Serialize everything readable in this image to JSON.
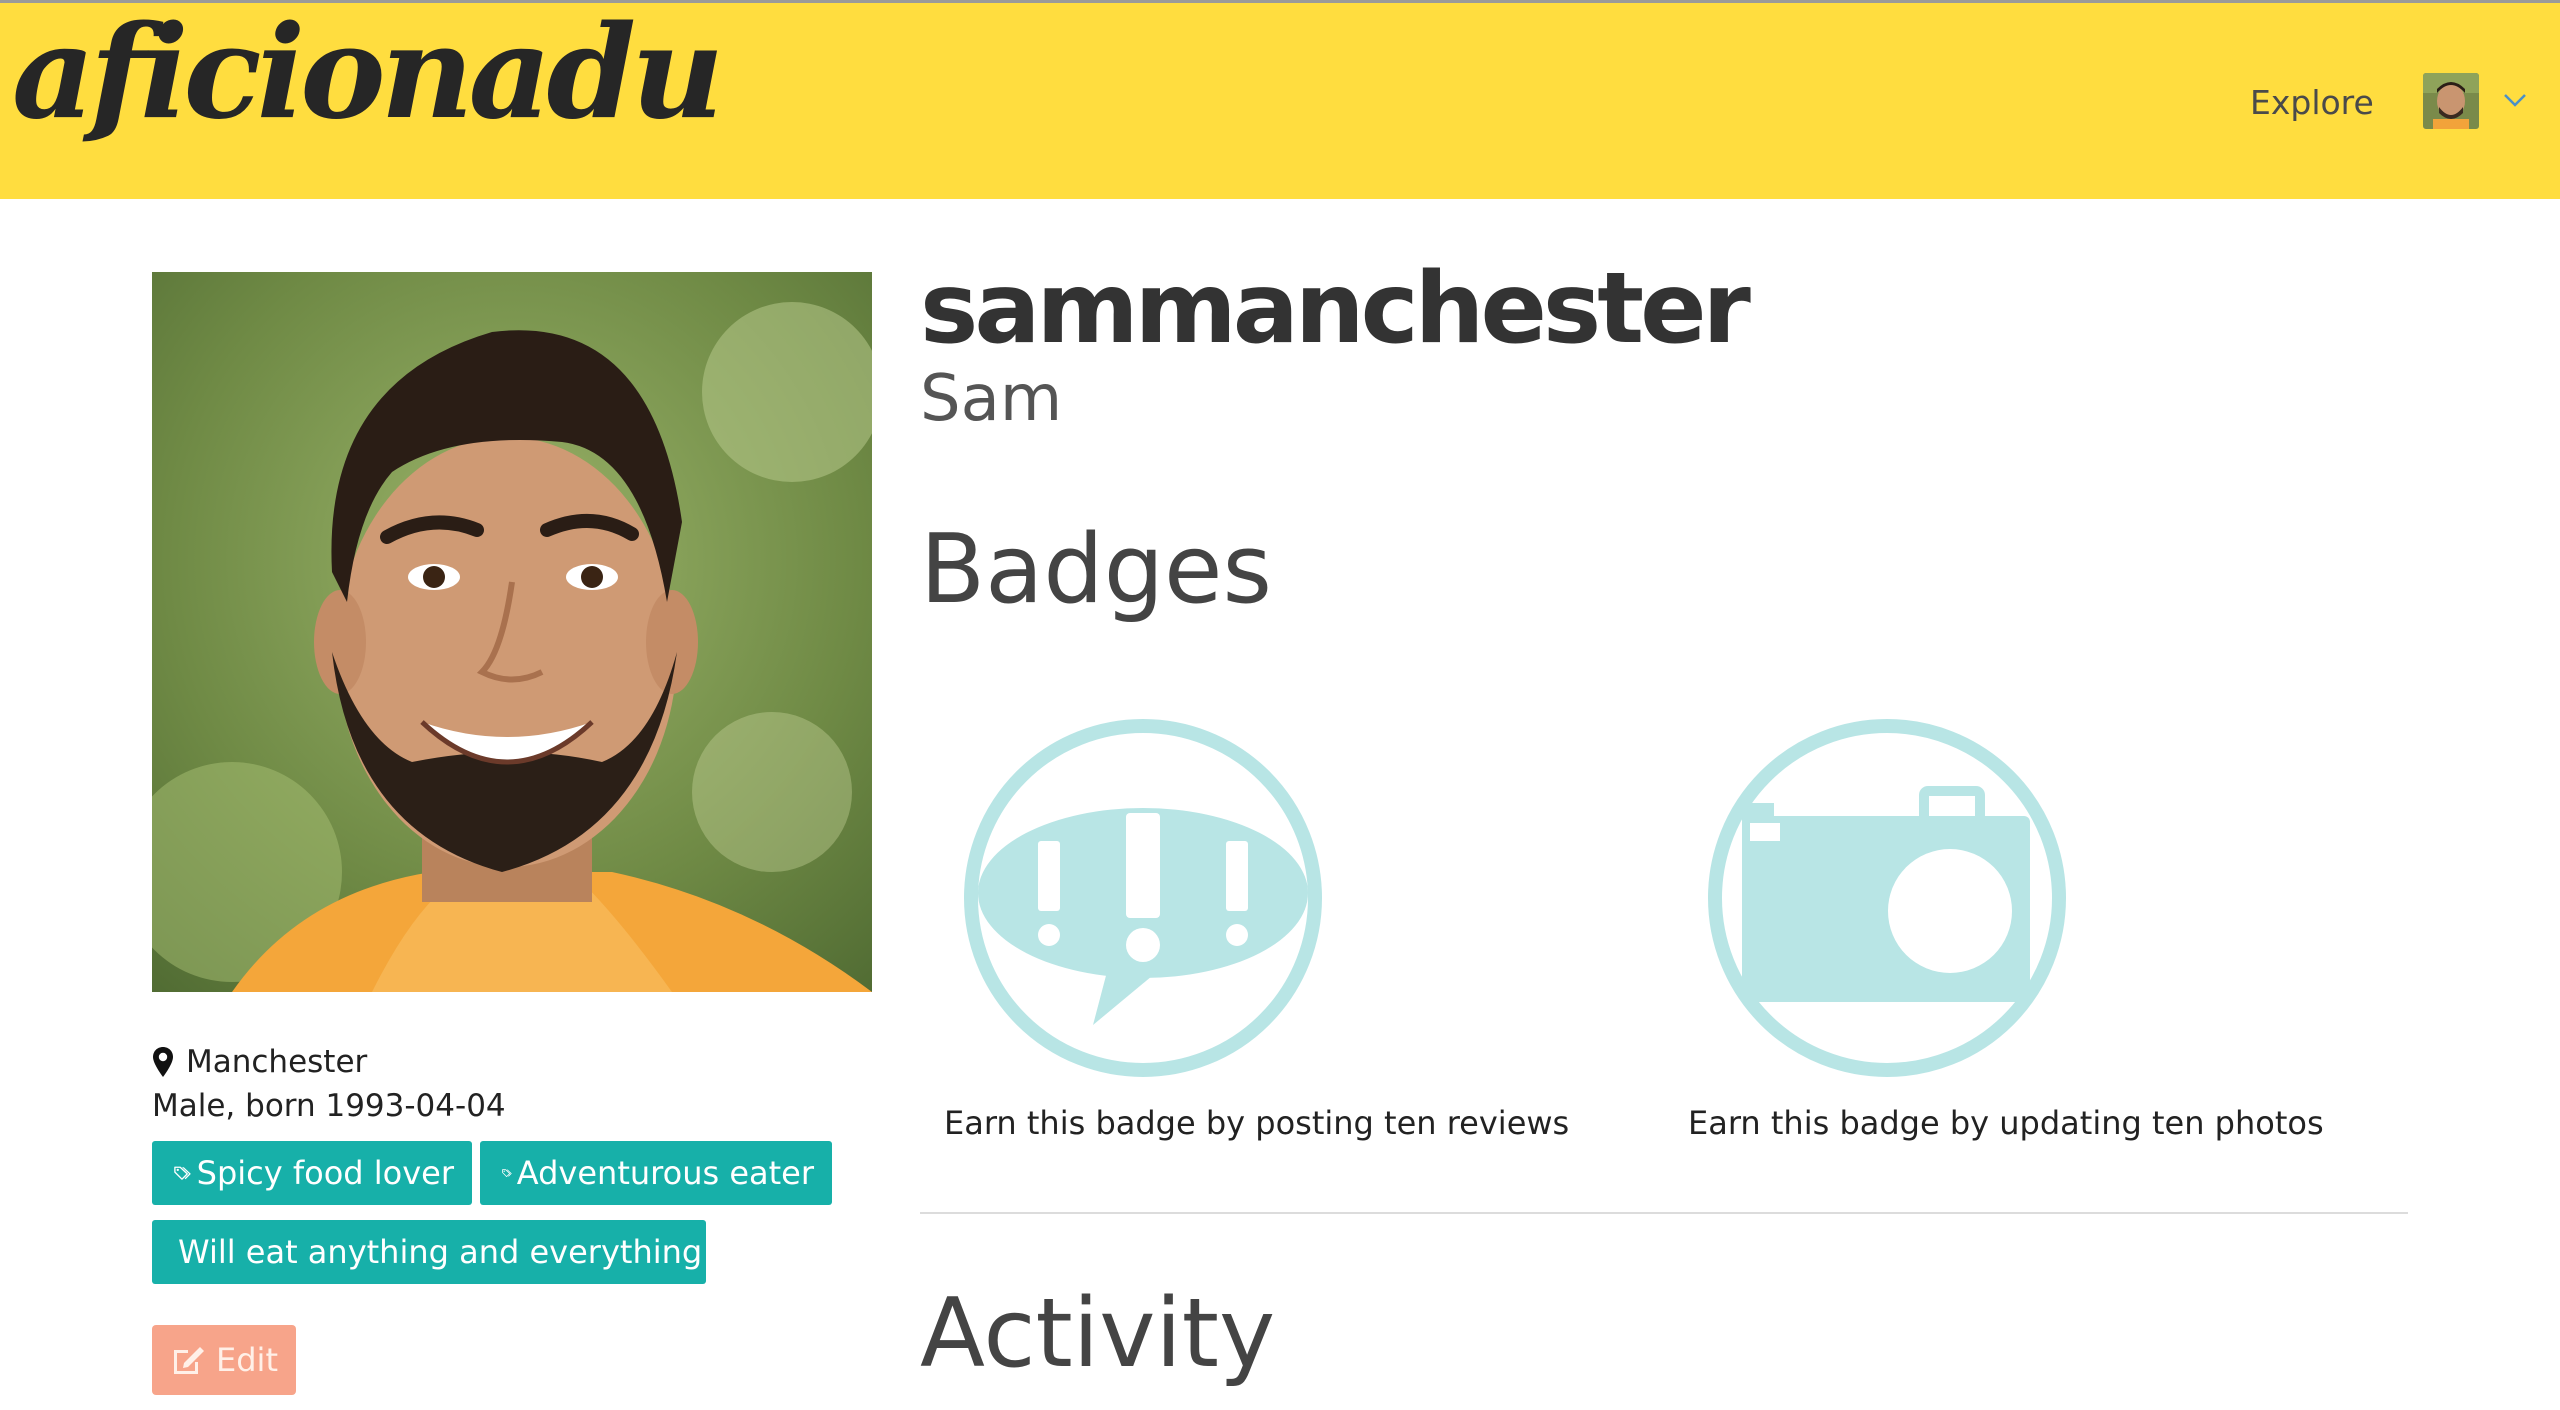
{
  "header": {
    "logo_text": "aficionadu",
    "nav_explore": "Explore",
    "background_color": "#ffdd3f",
    "avatar_icon": "user-avatar",
    "dropdown_icon": "chevron-down-icon"
  },
  "profile": {
    "username": "sammanchester",
    "display_name": "Sam",
    "location": "Manchester",
    "location_icon": "map-pin-icon",
    "details": "Male, born 1993-04-04",
    "tags": [
      {
        "label": "Spicy food lover",
        "icon": "tags-icon"
      },
      {
        "label": "Adventurous eater",
        "icon": "tags-icon"
      },
      {
        "label": "Will eat anything and everything",
        "icon": "tags-icon"
      }
    ],
    "tag_color": "#17b0a9",
    "edit_label": "Edit",
    "edit_icon": "edit-icon",
    "edit_color": "#f7a48a"
  },
  "badges": {
    "heading": "Badges",
    "items": [
      {
        "icon": "speech-bubble-exclamation-icon",
        "caption": "Earn this badge by posting ten reviews"
      },
      {
        "icon": "camera-icon",
        "caption": "Earn this badge by updating ten photos"
      }
    ],
    "icon_color": "#b8e5e5"
  },
  "activity": {
    "heading": "Activity"
  }
}
